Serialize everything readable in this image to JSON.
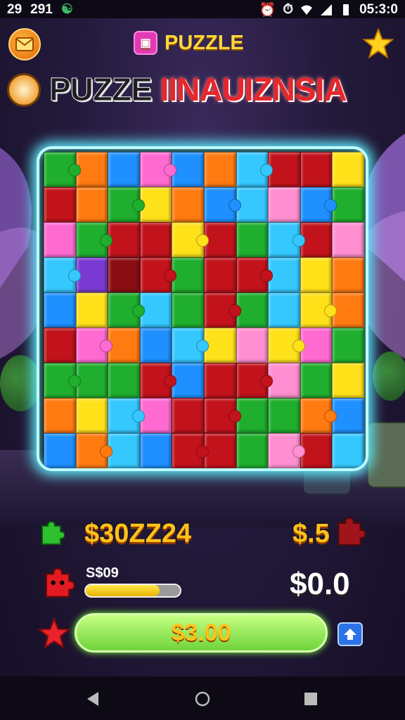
{
  "status_bar": {
    "left_1": "29",
    "left_2": "291",
    "time": "05:3:0"
  },
  "header": {
    "title": "PUZZLE",
    "badge_glyph": "▣"
  },
  "banner": {
    "title_part_1": "PUZZE ",
    "title_part_2": "IINAUIZNSIA"
  },
  "stats": {
    "green_value": "$30ZZ24",
    "red_right_value": "$.5",
    "small_label": "S$09",
    "progress_fraction": 0.78,
    "balance": "$0.0",
    "cta_label": "$3.00"
  },
  "icons": {
    "mail": "mail-icon",
    "star": "star-icon",
    "share": "share-icon"
  },
  "colors": {
    "board_glow": "#5feeff",
    "accent_gold": "#ffc21a",
    "cta_green": "#6fd43a"
  },
  "board": {
    "tiles": [
      "#1fae2d",
      "#ff7a10",
      "#1e90ff",
      "#ff6ad1",
      "#1e90ff",
      "#ff7a10",
      "#34c8ff",
      "#c2121b",
      "#c2121b",
      "#ffe11a",
      "#c2121b",
      "#ff7a10",
      "#1fae2d",
      "#ffe11a",
      "#ff7a10",
      "#1e90ff",
      "#34c8ff",
      "#ff8fd0",
      "#1e90ff",
      "#1fae2d",
      "#ff6ad1",
      "#1fae2d",
      "#c2121b",
      "#c2121b",
      "#ffe11a",
      "#c2121b",
      "#1fae2d",
      "#34c8ff",
      "#c2121b",
      "#ff8fd0",
      "#34c8ff",
      "#7a3ad1",
      "#8b0d14",
      "#c2121b",
      "#1fae2d",
      "#c2121b",
      "#c2121b",
      "#34c8ff",
      "#ffe11a",
      "#ff7a10",
      "#1e90ff",
      "#ffe11a",
      "#1fae2d",
      "#34c8ff",
      "#1fae2d",
      "#c2121b",
      "#1fae2d",
      "#34c8ff",
      "#ffe11a",
      "#ff7a10",
      "#c2121b",
      "#ff6ad1",
      "#ff7a10",
      "#1e90ff",
      "#34c8ff",
      "#ffe11a",
      "#ff8fd0",
      "#ffe11a",
      "#ff6ad1",
      "#1fae2d",
      "#1fae2d",
      "#1fae2d",
      "#1fae2d",
      "#c2121b",
      "#1e90ff",
      "#c2121b",
      "#c2121b",
      "#ff8fd0",
      "#1fae2d",
      "#ffe11a",
      "#ff7a10",
      "#ffe11a",
      "#34c8ff",
      "#ff6ad1",
      "#c2121b",
      "#c2121b",
      "#1fae2d",
      "#1fae2d",
      "#ff7a10",
      "#1e90ff",
      "#1e90ff",
      "#ff7a10",
      "#34c8ff",
      "#1e90ff",
      "#c2121b",
      "#c2121b",
      "#1fae2d",
      "#ff8fd0",
      "#c2121b",
      "#34c8ff"
    ]
  }
}
